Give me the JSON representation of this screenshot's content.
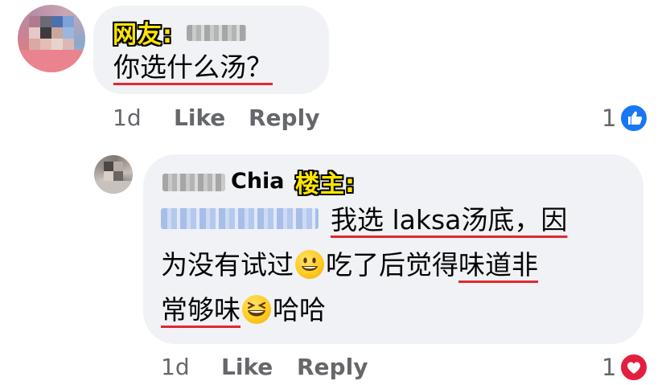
{
  "comment1": {
    "tag": "网友:",
    "text": "你选什么汤？",
    "time": "1d",
    "like_label": "Like",
    "reply_label": "Reply",
    "reaction_count": "1",
    "reaction_icon": "like-reaction-icon"
  },
  "comment2": {
    "author_suffix": "Chia",
    "tag": "楼主:",
    "line1_after_blur": "我选 laksa汤底，因",
    "line2_a": "为没有试过",
    "line2_b": "吃了后觉得",
    "line2_c": "味道非",
    "line3_a": "常够味",
    "line3_b": "哈哈",
    "time": "1d",
    "like_label": "Like",
    "reply_label": "Reply",
    "reaction_count": "1",
    "reaction_icon": "love-reaction-icon"
  },
  "colors": {
    "bubble": "#f0f2f5",
    "meta_text": "#65676b",
    "like_blue": "#1877f2",
    "love_red": "#e41e3f",
    "underline_red": "#e0282e",
    "tag_yellow": "#ffe600"
  }
}
